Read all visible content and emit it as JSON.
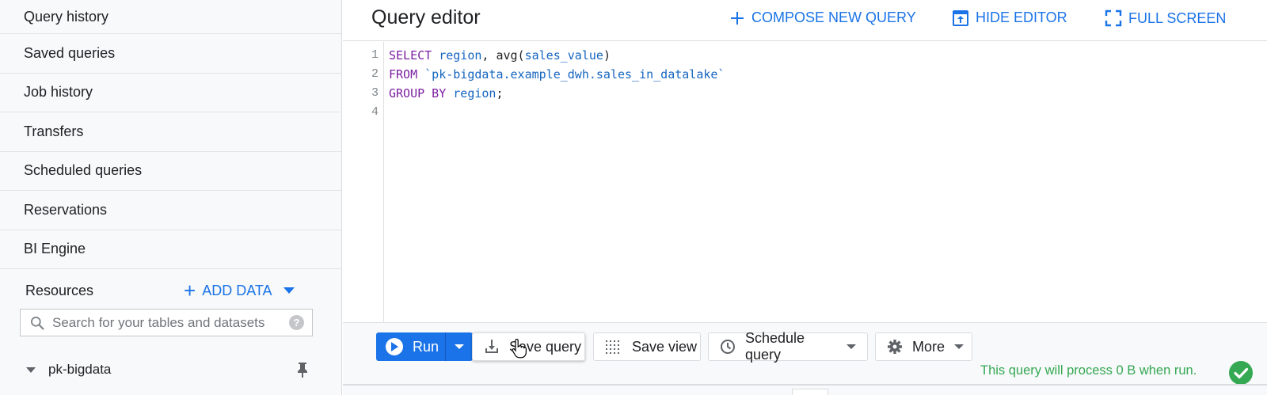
{
  "sidebar": {
    "items": [
      {
        "label": "Query history"
      },
      {
        "label": "Saved queries"
      },
      {
        "label": "Job history"
      },
      {
        "label": "Transfers"
      },
      {
        "label": "Scheduled queries"
      },
      {
        "label": "Reservations"
      },
      {
        "label": "BI Engine"
      }
    ],
    "resources_title": "Resources",
    "add_data_label": "ADD DATA",
    "search_placeholder": "Search for your tables and datasets",
    "project": "pk-bigdata"
  },
  "editor": {
    "title": "Query editor",
    "compose_label": "COMPOSE NEW QUERY",
    "hide_label": "HIDE EDITOR",
    "fullscreen_label": "FULL SCREEN",
    "line_numbers": [
      "1",
      "2",
      "3",
      "4"
    ],
    "code": {
      "l1_kw": "SELECT",
      "l1_col": "region",
      "l1_sep": ", ",
      "l1_fn": "avg(",
      "l1_arg": "sales_value",
      "l1_close": ")",
      "l2_kw": "FROM",
      "l2_table": "`pk-bigdata.example_dwh.sales_in_datalake`",
      "l3_kw": "GROUP BY",
      "l3_col": "region",
      "l3_end": ";"
    }
  },
  "toolbar": {
    "run_label": "Run",
    "save_query_label": "Save query",
    "save_view_label": "Save view",
    "schedule_label": "Schedule query",
    "more_label": "More",
    "status": "This query will process 0 B when run."
  },
  "colors": {
    "accent": "#1a73e8",
    "success": "#34a853",
    "keyword": "#7b1fa2",
    "identifier": "#1565c0"
  }
}
